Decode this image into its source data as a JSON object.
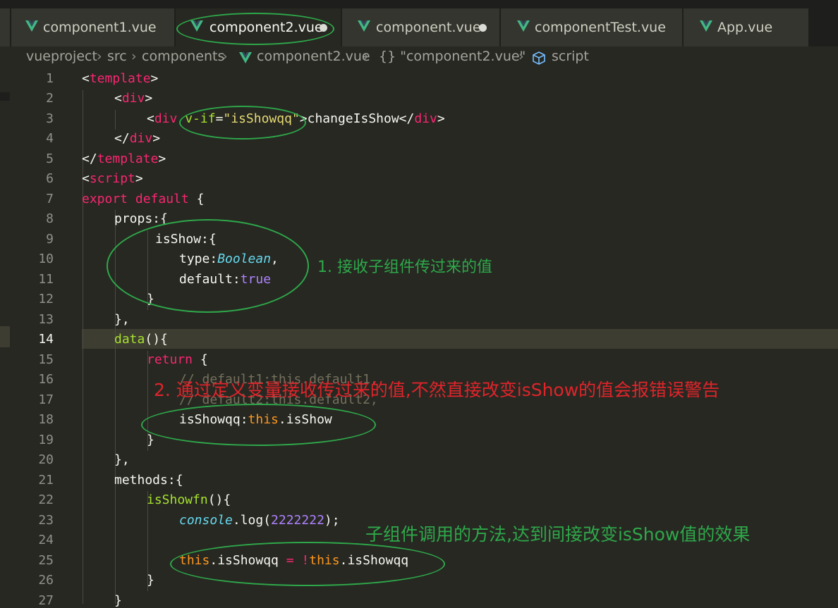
{
  "tabs": [
    {
      "label": "component1.vue",
      "active": false,
      "modified": false
    },
    {
      "label": "component2.vue",
      "active": true,
      "modified": true
    },
    {
      "label": "component.vue",
      "active": false,
      "modified": true
    },
    {
      "label": "componentTest.vue",
      "active": false,
      "modified": false
    },
    {
      "label": "App.vue",
      "active": false,
      "modified": false
    }
  ],
  "breadcrumb": {
    "project": "vueproject",
    "src": "src",
    "components": "components",
    "file": "component2.vue",
    "symbol": "{} \"component2.vue\"",
    "section": "script"
  },
  "editor": {
    "current_line": 14,
    "line_numbers": [
      "1",
      "2",
      "3",
      "4",
      "5",
      "6",
      "7",
      "8",
      "9",
      "10",
      "11",
      "12",
      "13",
      "14",
      "15",
      "16",
      "17",
      "18",
      "19",
      "20",
      "21",
      "22",
      "23",
      "24",
      "25",
      "26",
      "27"
    ]
  },
  "code": {
    "l1_open": "<",
    "l1_tag": "template",
    "l1_close": ">",
    "l2_open": "<",
    "l2_tag": "div",
    "l2_close": ">",
    "l3_open": "<",
    "l3_tag": "div",
    "l3_attr": "v-if",
    "l3_eq": "=",
    "l3_str": "\"isShowqq\"",
    "l3_gt": ">",
    "l3_text": "changeIsShow",
    "l3_lt": "</",
    "l3_tag2": "div",
    "l3_end": ">",
    "l4_open": "</",
    "l4_tag": "div",
    "l4_close": ">",
    "l5_open": "</",
    "l5_tag": "template",
    "l5_close": ">",
    "l6_open": "<",
    "l6_tag": "script",
    "l6_close": ">",
    "l7_kw1": "export",
    "l7_kw2": "default",
    "l7_rest": " {",
    "l8": "props:{",
    "l9": "isShow:{",
    "l10_key": "type:",
    "l10_type": "Boolean",
    "l10_end": ",",
    "l11_key": "default:",
    "l11_val": "true",
    "l12": "}",
    "l13": "},",
    "l14_fn": "data",
    "l14_rest": "(){",
    "l15_kw": "return",
    "l15_rest": " {",
    "l16": "// default1:this.default1,",
    "l17": "// default2:this.default2,",
    "l18_key": "isShowqq:",
    "l18_this": "this",
    "l18_rest": ".isShow",
    "l19": "}",
    "l20": "},",
    "l21": "methods:{",
    "l22_fn": "isShowfn",
    "l22_rest": "(){",
    "l23_obj": "console",
    "l23_dot": ".log(",
    "l23_num": "2222222",
    "l23_end": ");",
    "l25_this1": "this",
    "l25_mid": ".isShowqq ",
    "l25_op": "= !",
    "l25_this2": "this",
    "l25_end": ".isShowqq",
    "l26": "}",
    "l27": "}"
  },
  "annotations": {
    "note1": "1.  接收子组件传过来的值",
    "note2": "2.  通过定义变量接收传过来的值,不然直接改变isShow的值会报错误警告",
    "note3": "子组件调用的方法,达到间接改变isShow值的效果"
  },
  "colors": {
    "background": "#272822",
    "annotation_green": "#2ea84a",
    "annotation_red": "#e0242a",
    "vue_logo": "#41b883"
  }
}
